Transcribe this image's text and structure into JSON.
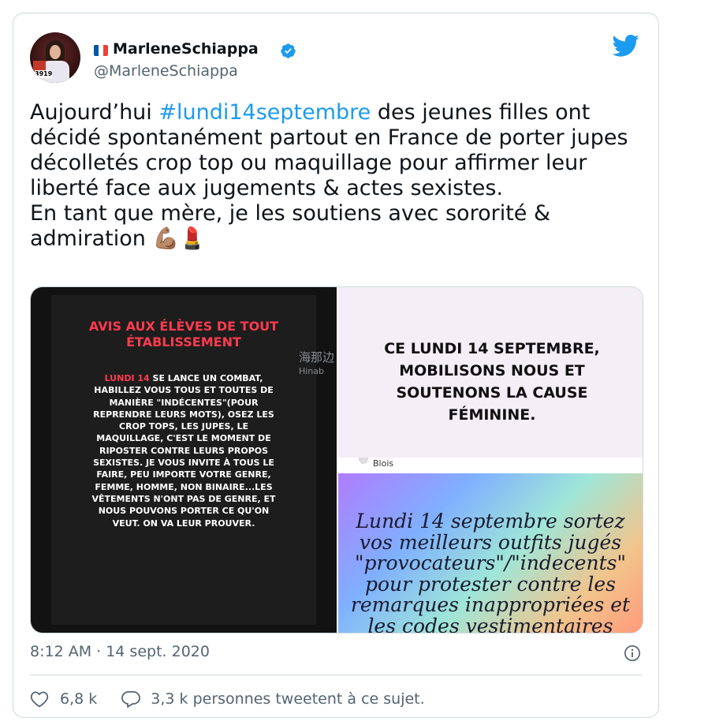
{
  "user": {
    "display_name": "MarleneSchiappa",
    "handle": "@MarleneSchiappa",
    "flag_icon": "france-flag-icon",
    "verified_icon": "verified-badge-icon",
    "avatar_badge": "3919",
    "avatar_badge_top": "3 9 1 9"
  },
  "tweet": {
    "text_before": "Aujourd’hui ",
    "hashtag": "#lundi14septembre",
    "text_after": " des jeunes filles ont décidé spontanément partout en France de porter jupes décolletés crop top ou maquillage pour affirmer leur liberté face aux jugements & actes sexistes.",
    "line2": "En tant que mère, je les soutiens avec sororité & admiration ",
    "emojis": "💪🏽💄",
    "timestamp": "8:12 AM · 14 sept. 2020"
  },
  "media": {
    "left_title": "AVIS AUX ÉLÈVES DE TOUT ÉTABLISSEMENT",
    "left_highlight": "LUNDI 14",
    "left_body": " SE LANCE UN COMBAT, HABILLEZ VOUS TOUS ET TOUTES DE MANIÈRE \"INDÉCENTES\"(POUR REPRENDRE LEURS MOTS), OSEZ LES CROP TOPS, LES JUPES, LE MAQUILLAGE, C'EST LE MOMENT DE RIPOSTER CONTRE LEURS PROPOS SEXISTES. JE VOUS INVITE À TOUS LE FAIRE, PEU IMPORTE VOTRE GENRE, FEMME, HOMME, NON BINAIRE...LES VÊTEMENTS N'ONT PAS DE GENRE, ET NOUS POUVONS PORTER CE QU'ON VEUT. ON VA LEUR PROUVER.",
    "watermark": "海那边",
    "watermark_sub": "Hinab",
    "top_right_text": "CE LUNDI 14 SEPTEMBRE, MOBILISONS NOUS ET SOUTENONS LA CAUSE FÉMININE.",
    "top_right_footer": "Blois",
    "bottom_right_text": "Lundi 14 septembre sortez vos meilleurs outfits jugés \"provocateurs\"/\"indecents\" pour protester contre les remarques inappropriées et les codes vestimentaires"
  },
  "actions": {
    "likes": "6,8 k",
    "retweets_label": "3,3 k personnes tweetent à ce sujet."
  },
  "colors": {
    "accent": "#1d9bf0",
    "text": "#0f1419",
    "muted": "#536471",
    "border": "#cfd9de",
    "red_text": "#ff3b4e"
  }
}
